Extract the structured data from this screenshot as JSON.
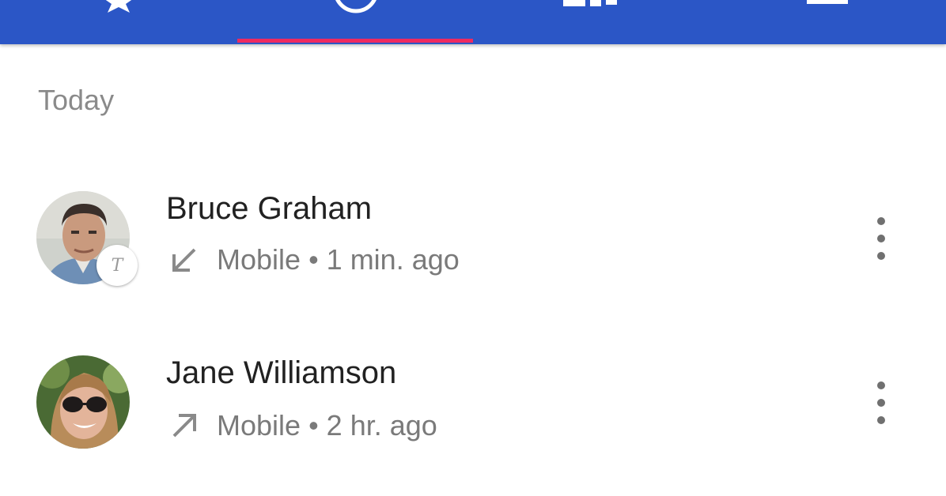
{
  "appbar": {
    "background": "#2b56c6",
    "indicator_color": "#ee2a60",
    "tabs": [
      {
        "icon": "star-icon",
        "selected": false
      },
      {
        "icon": "clock-icon",
        "selected": true
      },
      {
        "icon": "contacts-grid-icon",
        "selected": false
      },
      {
        "icon": "voicemail-icon",
        "selected": false
      }
    ]
  },
  "section": {
    "header": "Today"
  },
  "calls": [
    {
      "name": "Bruce Graham",
      "direction": "incoming-arrow-icon",
      "line": "Mobile",
      "separator": "•",
      "time": "1 min. ago",
      "badge": "T"
    },
    {
      "name": "Jane Williamson",
      "direction": "outgoing-arrow-icon",
      "line": "Mobile",
      "separator": "•",
      "time": "2 hr. ago"
    }
  ]
}
